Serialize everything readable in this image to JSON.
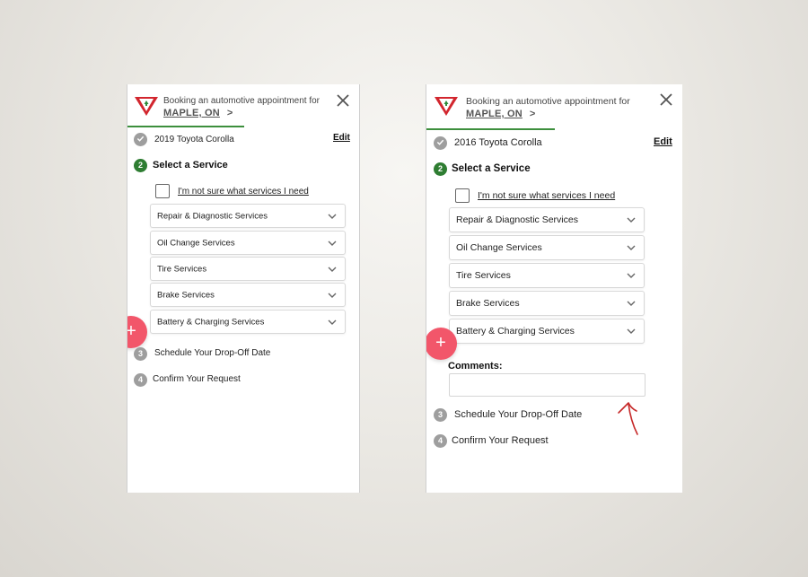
{
  "brand": {
    "logo_color": "#d2262e",
    "accent_green": "#2e7d32",
    "fab_color": "#f2566a",
    "annotation_color": "#c62828"
  },
  "screens": [
    {
      "header": {
        "booking_text": "Booking an automotive appointment for",
        "location": "MAPLE, ON",
        "location_arrow": ">",
        "close_icon": "close-icon"
      },
      "vehicle": {
        "label": "2019 Toyota Corolla",
        "edit_label": "Edit"
      },
      "step2": {
        "number": "2",
        "title": "Select a Service"
      },
      "unsure_label": "I'm not sure what services I need",
      "services": [
        "Repair & Diagnostic Services",
        "Oil Change Services",
        "Tire Services",
        "Brake Services",
        "Battery & Charging Services"
      ],
      "fab_label": "+",
      "step3": {
        "number": "3",
        "label": "Schedule Your Drop-Off Date"
      },
      "step4": {
        "number": "4",
        "label": "Confirm Your Request"
      }
    },
    {
      "header": {
        "booking_text": "Booking an automotive appointment for",
        "location": "MAPLE, ON",
        "location_arrow": ">",
        "close_icon": "close-icon"
      },
      "vehicle": {
        "label": "2016 Toyota Corolla",
        "edit_label": "Edit"
      },
      "step2": {
        "number": "2",
        "title": "Select a Service"
      },
      "unsure_label": "I'm not sure what services I need",
      "services": [
        "Repair & Diagnostic Services",
        "Oil Change Services",
        "Tire Services",
        "Brake Services",
        "Battery & Charging Services"
      ],
      "fab_label": "+",
      "comments": {
        "label": "Comments:",
        "value": "",
        "placeholder": ""
      },
      "step3": {
        "number": "3",
        "label": "Schedule Your Drop-Off Date"
      },
      "step4": {
        "number": "4",
        "label": "Confirm Your Request"
      }
    }
  ]
}
